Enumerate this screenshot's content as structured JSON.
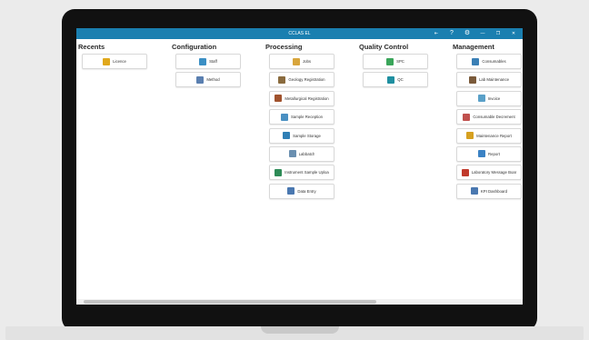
{
  "window": {
    "title": "CCLAS EL",
    "controls": {
      "logout": "⇤",
      "help": "?",
      "settings": "⚙",
      "minimize": "—",
      "maximize": "❐",
      "close": "✕"
    },
    "title_bar_color": "#1a7fb0"
  },
  "columns": [
    {
      "title": "Recents",
      "items": [
        {
          "label": "Licence",
          "icon": "lock-icon",
          "color": "#e0a81c"
        }
      ]
    },
    {
      "title": "Configuration",
      "items": [
        {
          "label": "Staff",
          "icon": "people-icon",
          "color": "#3b8fc4"
        },
        {
          "label": "Method",
          "icon": "gears-icon",
          "color": "#5a7fb0"
        }
      ]
    },
    {
      "title": "Processing",
      "items": [
        {
          "label": "Jobs",
          "icon": "briefcase-icon",
          "color": "#d8a53c"
        },
        {
          "label": "Geology Registration",
          "icon": "pickaxe-icon",
          "color": "#8a6b3e"
        },
        {
          "label": "Metallurgical Registration",
          "icon": "furnace-icon",
          "color": "#a0522d"
        },
        {
          "label": "Sample Reception",
          "icon": "clipboard-icon",
          "color": "#4a90c2"
        },
        {
          "label": "Sample Storage",
          "icon": "storage-icon",
          "color": "#2f7fb5"
        },
        {
          "label": "Labbatch",
          "icon": "flask-icon",
          "color": "#6a8fb0"
        },
        {
          "label": "Instrument Sample Uploa",
          "icon": "instrument-icon",
          "color": "#2e8b57"
        },
        {
          "label": "Data Entry",
          "icon": "keyboard-icon",
          "color": "#4a78b0"
        }
      ]
    },
    {
      "title": "Quality Control",
      "items": [
        {
          "label": "SPC",
          "icon": "chart-icon",
          "color": "#3aa55a"
        },
        {
          "label": "QC",
          "icon": "qc-icon",
          "color": "#1f8fa0"
        }
      ]
    },
    {
      "title": "Management",
      "items": [
        {
          "label": "Consumables",
          "icon": "bottle-icon",
          "color": "#3a7fb5"
        },
        {
          "label": "Lab Maintenance",
          "icon": "toolbox-icon",
          "color": "#7a5a3a"
        },
        {
          "label": "Invoice",
          "icon": "invoice-icon",
          "color": "#5aa0c8"
        },
        {
          "label": "Consumable Decrement",
          "icon": "decrement-icon",
          "color": "#c0504d"
        },
        {
          "label": "Maintenance Report",
          "icon": "wrench-report-icon",
          "color": "#d6a020"
        },
        {
          "label": "Report",
          "icon": "report-icon",
          "color": "#3b82c4"
        },
        {
          "label": "Laboratory Message Boar",
          "icon": "message-pin-icon",
          "color": "#c0392b"
        },
        {
          "label": "KPI Dashboard",
          "icon": "dashboard-icon",
          "color": "#4a78b0"
        }
      ]
    }
  ]
}
